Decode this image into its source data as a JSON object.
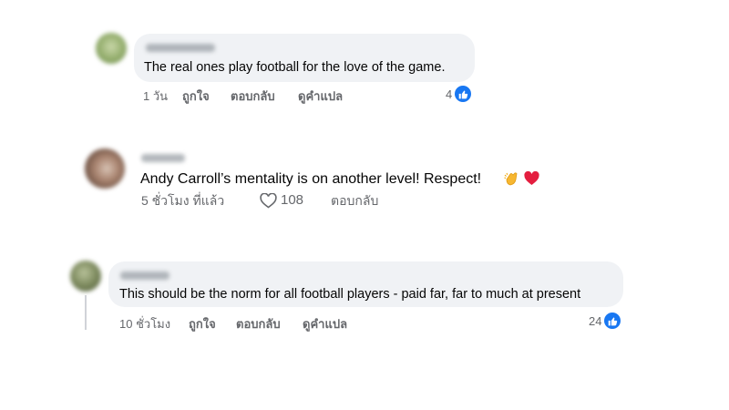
{
  "comments": [
    {
      "author": "Jo Robertson",
      "text": "The real ones play football for the love of the game.",
      "time": "1 วัน",
      "like_action": "ถูกใจ",
      "reply_action": "ตอบกลับ",
      "translate_action": "ดูคำแปล",
      "reaction_count": "4",
      "reaction_icon": "like-icon"
    },
    {
      "author": "Amanda",
      "text": "Andy Carroll’s mentality is on another level! Respect!",
      "time": "5 ชั่วโมง ที่แล้ว",
      "like_count": "108",
      "reply_action": "ตอบกลับ",
      "emojis": [
        "clapping-hands-icon",
        "red-heart-icon"
      ]
    },
    {
      "author": "Alan Mills",
      "text": "This should be the norm for all football players - paid far, far to much at present",
      "time": "10 ชั่วโมง",
      "like_action": "ถูกใจ",
      "reply_action": "ตอบกลับ",
      "translate_action": "ดูคำแปล",
      "reaction_count": "24",
      "reaction_icon": "like-icon"
    }
  ],
  "colors": {
    "bubble": "#f0f2f5",
    "meta_text": "#65676b",
    "like_blue": "#1877f2",
    "heart_red": "#e41e3f"
  }
}
